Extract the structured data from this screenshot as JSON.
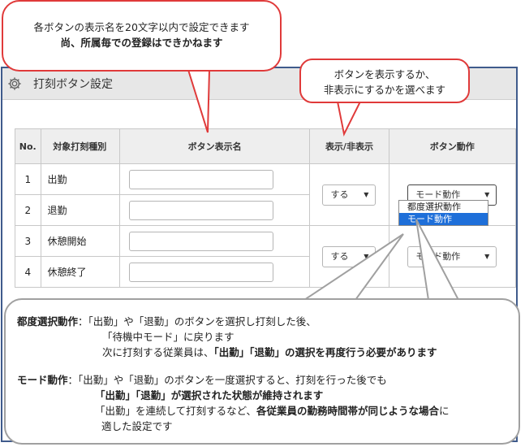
{
  "panel": {
    "title": "打刻ボタン設定"
  },
  "table": {
    "headers": {
      "no": "No.",
      "type": "対象打刻種別",
      "name": "ボタン表示名",
      "show": "表示/非表示",
      "action": "ボタン動作"
    },
    "rows": [
      {
        "no": "1",
        "type": "出勤"
      },
      {
        "no": "2",
        "type": "退勤"
      },
      {
        "no": "3",
        "type": "休憩開始"
      },
      {
        "no": "4",
        "type": "休憩終了"
      }
    ],
    "groups": [
      {
        "show": "する",
        "action": "モード動作"
      },
      {
        "show": "する",
        "action": "モード動作"
      }
    ]
  },
  "dropdown": {
    "options": [
      "都度選択動作",
      "モード動作"
    ],
    "selected_index": 1
  },
  "callouts": {
    "top": {
      "line1": "各ボタンの表示名を20文字以内で設定できます",
      "line2": "尚、所属毎での登録はできかねます"
    },
    "right": {
      "line1": "ボタンを表示するか、",
      "line2": "非表示にするかを選べます"
    },
    "bottom": {
      "row1_label": "都度選択動作",
      "row1_colon": "：",
      "row1_text": "「出勤」や「退勤」のボタンを選択し打刻した後、",
      "row2": "「待機中モード」に戻ります",
      "row3_normal": "次に打刻する従業員は、",
      "row3_bold": "「出勤」「退勤」の選択を再度行う必要があります",
      "row4_label": "モード動作",
      "row4_colon": "：",
      "row4_text": "「出勤」や「退勤」のボタンを一度選択すると、打刻を行った後でも",
      "row5_bold": "「出勤」「退勤」",
      "row5_bold2": "が選択された状態が維持されます",
      "row6_normal": "「出勤」を連続して打刻するなど、",
      "row6_bold": "各従業員の勤務時間帯が同じような場合",
      "row6_tail": "に",
      "row7": "適した設定です"
    }
  },
  "colors": {
    "accent_red": "#e03a3a",
    "panel_border": "#3f5b8c",
    "selection_blue": "#1e6fd9"
  }
}
